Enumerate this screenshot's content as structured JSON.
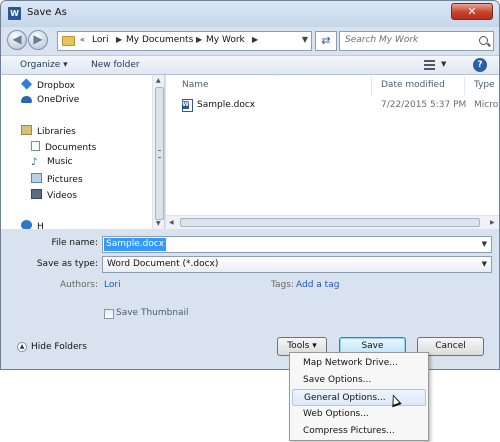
{
  "window": {
    "title": "Save As",
    "close_label": "✕"
  },
  "nav": {
    "back_label": "◀",
    "forward_label": "▶",
    "path": [
      "Lori",
      "My Documents",
      "My Work"
    ],
    "path_prefix": "«",
    "search_placeholder": "Search My Work"
  },
  "toolbar": {
    "organize_label": "Organize ▾",
    "new_folder_label": "New folder",
    "help_label": "?"
  },
  "navpane": {
    "items": [
      {
        "label": "Dropbox",
        "icon": "dropbox-icon"
      },
      {
        "label": "OneDrive",
        "icon": "onedrive-icon"
      },
      {
        "label": "Libraries",
        "icon": "libraries-icon"
      },
      {
        "label": "Documents",
        "icon": "documents-icon"
      },
      {
        "label": "Music",
        "icon": "music-icon"
      },
      {
        "label": "Pictures",
        "icon": "pictures-icon"
      },
      {
        "label": "Videos",
        "icon": "videos-icon"
      },
      {
        "label": "H",
        "icon": "homegroup-icon"
      }
    ]
  },
  "files": {
    "columns": [
      "Name",
      "Date modified",
      "Type"
    ],
    "rows": [
      {
        "name": "Sample.docx",
        "date": "7/22/2015 5:37 PM",
        "type": "Micro"
      }
    ]
  },
  "form": {
    "filename_label": "File name:",
    "filename_value": "Sample.docx",
    "savetype_label": "Save as type:",
    "savetype_value": "Word Document (*.docx)",
    "authors_label": "Authors:",
    "authors_value": "Lori",
    "tags_label": "Tags:",
    "tags_value": "Add a tag",
    "thumbnail_label": "Save Thumbnail"
  },
  "footer": {
    "hide_folders_label": "Hide Folders",
    "tools_label": "Tools ▾",
    "save_label": "Save",
    "cancel_label": "Cancel"
  },
  "tools_menu": {
    "items": [
      "Map Network Drive...",
      "Save Options...",
      "General Options...",
      "Web Options...",
      "Compress Pictures..."
    ],
    "highlighted_index": 2
  }
}
